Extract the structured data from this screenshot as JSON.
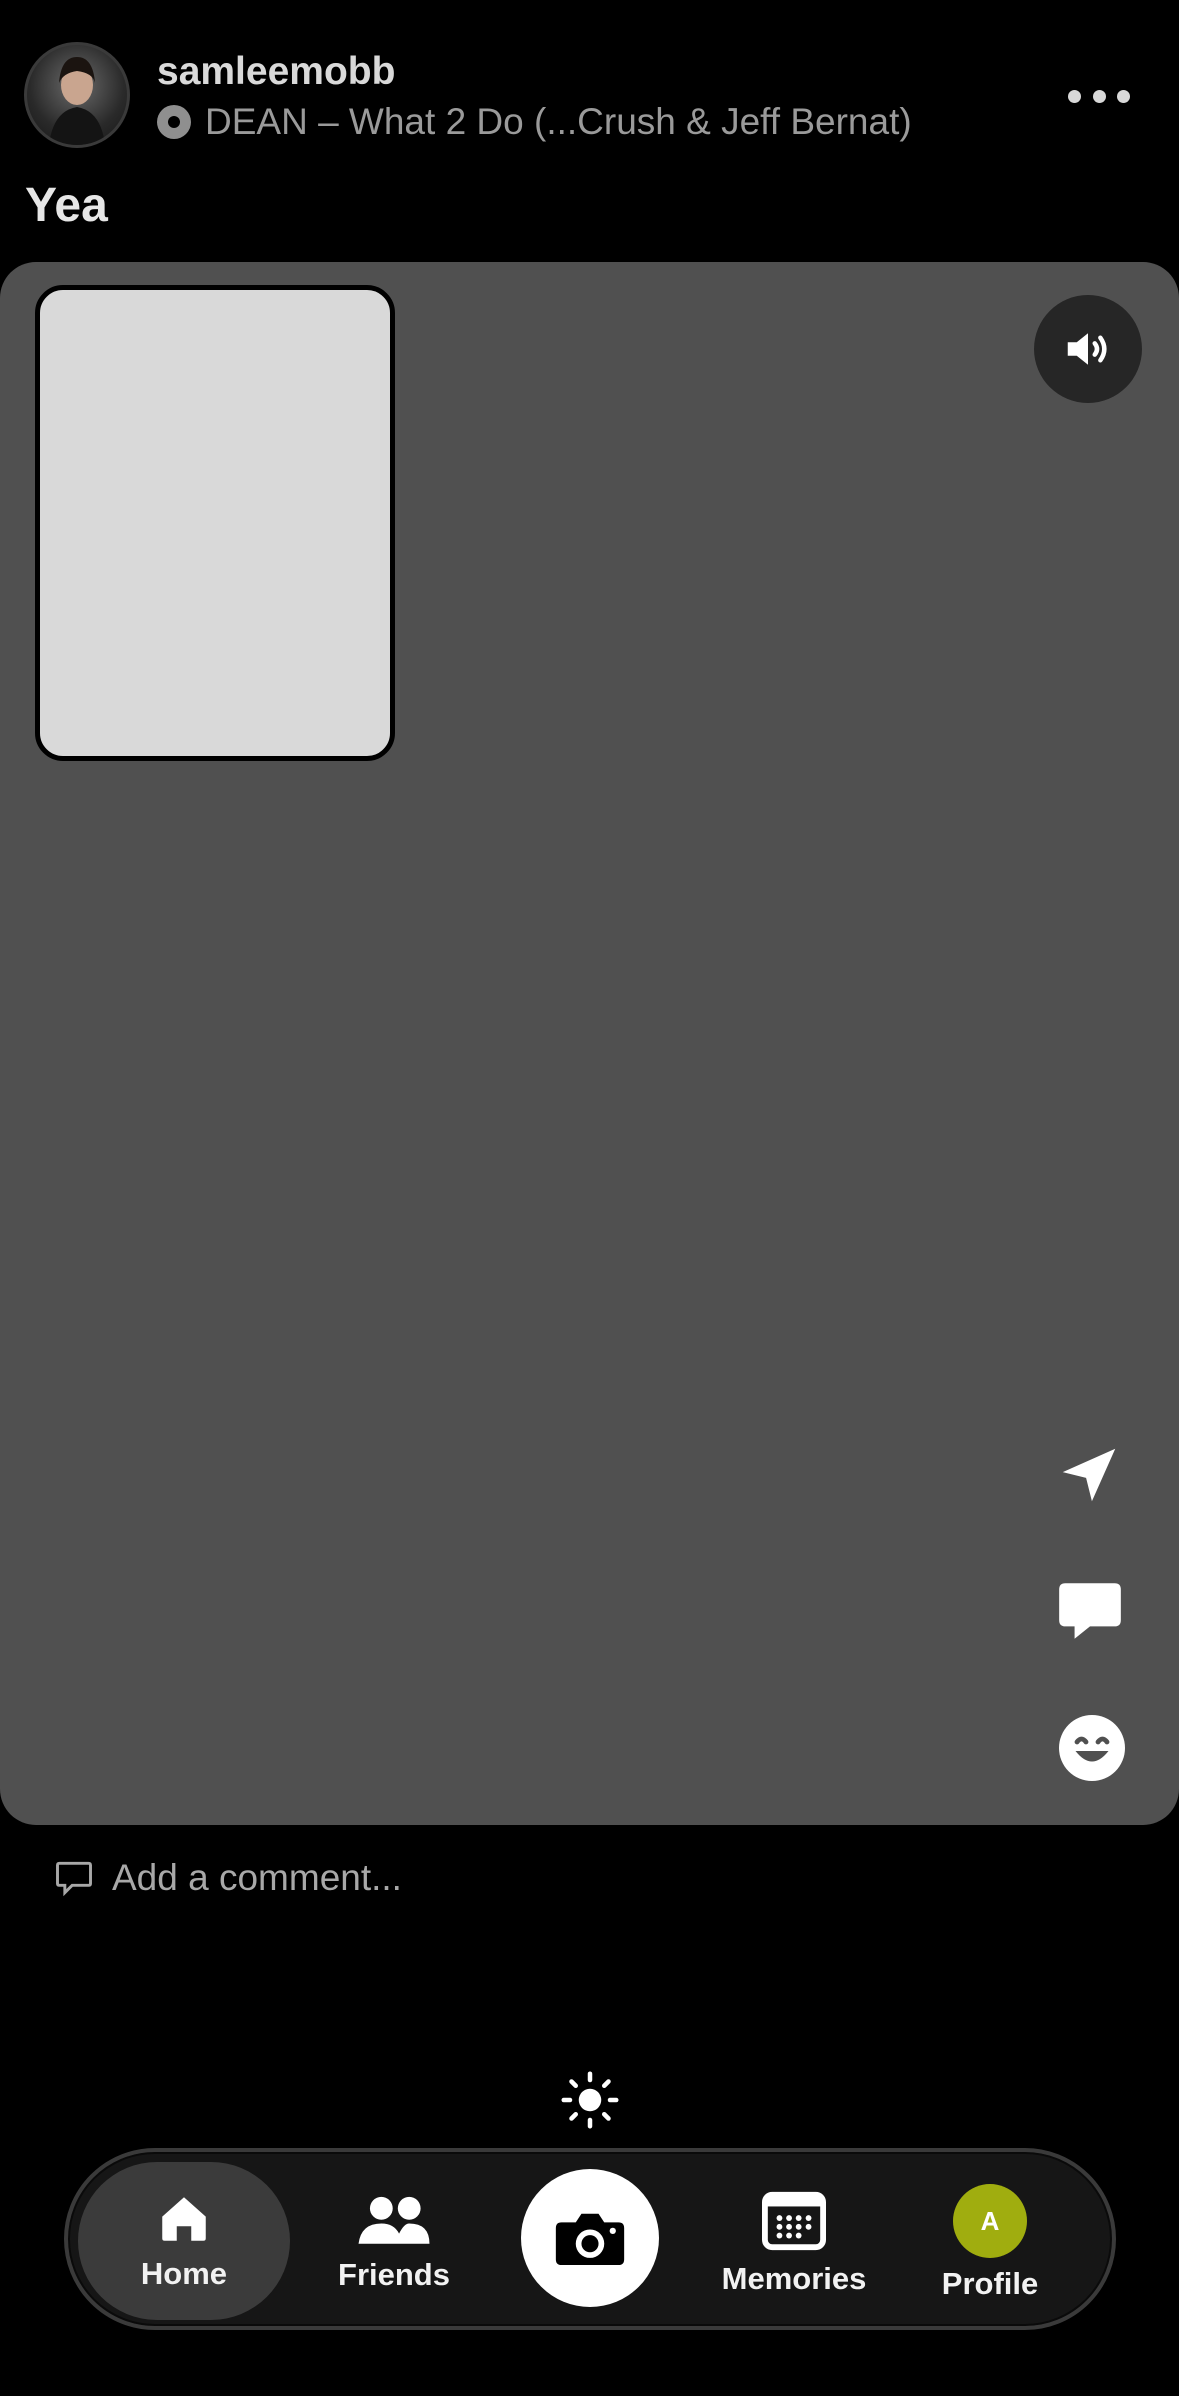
{
  "post": {
    "username": "samleemobb",
    "song": "DEAN – What 2 Do (...Crush & Jeff Bernat)",
    "caption": "Yea",
    "add_comment_placeholder": "Add a comment..."
  },
  "nav": {
    "items": [
      {
        "label": "Home",
        "icon": "home-icon",
        "active": true
      },
      {
        "label": "Friends",
        "icon": "friends-icon"
      },
      {
        "label": "Memories",
        "icon": "calendar-icon"
      },
      {
        "label": "Profile",
        "icon": "profile-avatar",
        "initial": "A"
      }
    ],
    "camera_icon": "camera-icon"
  },
  "icons": {
    "more": "more-horizontal-icon",
    "sound": "speaker-icon",
    "send": "send-icon",
    "comment": "comment-icon",
    "react": "smiley-icon",
    "brightness": "sun-icon"
  },
  "colors": {
    "background": "#000000",
    "post_background": "#505050",
    "profile_accent": "#a0ad0f"
  }
}
